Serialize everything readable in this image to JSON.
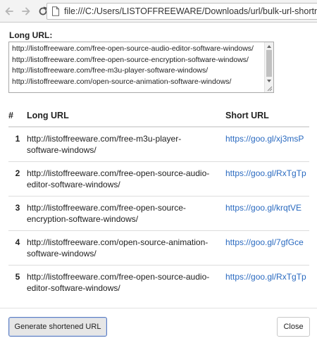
{
  "browser": {
    "url": "file:///C:/Users/LISTOFFREEWARE/Downloads/url/bulk-url-shortner-master--obt"
  },
  "form": {
    "long_url_label": "Long URL:",
    "textarea_lines": [
      "http://listoffreeware.com/free-open-source-audio-editor-software-windows/",
      "http://listoffreeware.com/free-open-source-encryption-software-windows/",
      "http://listoffreeware.com/free-m3u-player-software-windows/",
      "http://listoffreeware.com/open-source-animation-software-windows/"
    ]
  },
  "table": {
    "headers": {
      "num": "#",
      "long": "Long URL",
      "short": "Short URL"
    },
    "rows": [
      {
        "num": "1",
        "long_1": "http://listoffreeware.com/free-m3u-player-",
        "long_2": "software-windows/",
        "short": "https://goo.gl/xj3msP"
      },
      {
        "num": "2",
        "long_1": "http://listoffreeware.com/free-open-source-audio-",
        "long_2": "editor-software-windows/",
        "short": "https://goo.gl/RxTgTp"
      },
      {
        "num": "3",
        "long_1": "http://listoffreeware.com/free-open-source-",
        "long_2": "encryption-software-windows/",
        "short": "https://goo.gl/krqtVE"
      },
      {
        "num": "4",
        "long_1": "http://listoffreeware.com/open-source-animation-",
        "long_2": "software-windows/",
        "short": "https://goo.gl/7gfGce"
      },
      {
        "num": "5",
        "long_1": "http://listoffreeware.com/free-open-source-audio-",
        "long_2": "editor-software-windows/",
        "short": "https://goo.gl/RxTgTp"
      }
    ]
  },
  "buttons": {
    "generate": "Generate shortened URL",
    "close": "Close"
  },
  "colors": {
    "link": "#2a6ac0",
    "primary_border": "#5b7cbf"
  },
  "icons": [
    "arrow-left-icon",
    "arrow-right-icon",
    "reload-icon",
    "page-icon"
  ]
}
